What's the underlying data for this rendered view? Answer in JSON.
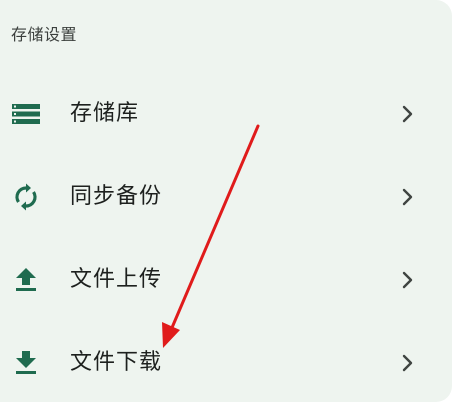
{
  "section": {
    "title": "存储设置"
  },
  "items": [
    {
      "label": "存储库",
      "icon": "storage-list-icon"
    },
    {
      "label": "同步备份",
      "icon": "sync-icon"
    },
    {
      "label": "文件上传",
      "icon": "upload-icon"
    },
    {
      "label": "文件下载",
      "icon": "download-icon"
    }
  ],
  "colors": {
    "panel_background": "#eef4ef",
    "icon": "#1f6b4f",
    "text": "#1d201e",
    "chevron": "#3f4441",
    "annotation_arrow": "#e01b1b"
  }
}
